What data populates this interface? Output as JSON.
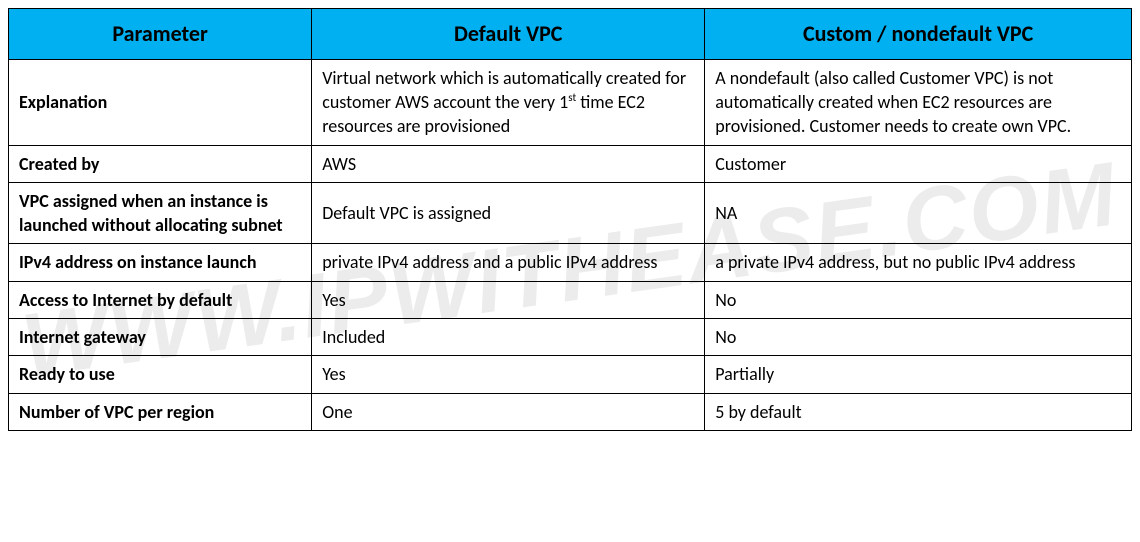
{
  "watermark": "WWW.IPWITHEASE.COM",
  "chart_data": {
    "type": "table",
    "title": "",
    "headers": [
      "Parameter",
      "Default VPC",
      "Custom / nondefault VPC"
    ],
    "rows": [
      {
        "parameter": "Explanation",
        "default_vpc": "Virtual network which is automatically created for customer AWS account the very 1st time  EC2 resources are provisioned",
        "custom_vpc": "A nondefault (also called Customer VPC) is not automatically created when EC2 resources are provisioned. Customer needs to create own VPC."
      },
      {
        "parameter": "Created by",
        "default_vpc": "AWS",
        "custom_vpc": "Customer"
      },
      {
        "parameter": "VPC assigned when an instance is launched without allocating subnet",
        "default_vpc": "Default VPC is assigned",
        "custom_vpc": "NA"
      },
      {
        "parameter": "IPv4 address  on instance launch",
        "default_vpc": "private IPv4 address and a public IPv4 address",
        "custom_vpc": "a private IPv4 address, but no public IPv4 address"
      },
      {
        "parameter": "Access to Internet by default",
        "default_vpc": "Yes",
        "custom_vpc": "No"
      },
      {
        "parameter": "Internet gateway",
        "default_vpc": "Included",
        "custom_vpc": "No"
      },
      {
        "parameter": "Ready to use",
        "default_vpc": "Yes",
        "custom_vpc": "Partially"
      },
      {
        "parameter": "Number of VPC per region",
        "default_vpc": "One",
        "custom_vpc": "5 by default"
      }
    ]
  }
}
